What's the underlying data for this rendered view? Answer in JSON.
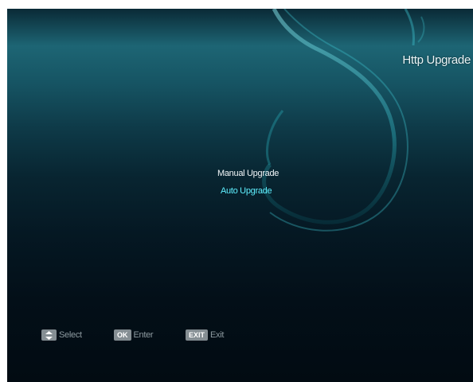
{
  "screen": {
    "title": "Http Upgrade"
  },
  "menu": {
    "items": [
      {
        "label": "Manual Upgrade",
        "selected": true
      },
      {
        "label": "Auto Upgrade",
        "selected": false
      }
    ]
  },
  "footer": {
    "hints": [
      {
        "key": "",
        "key_icon": "up-down-arrows-icon",
        "label": "Select"
      },
      {
        "key": "OK",
        "label": "Enter"
      },
      {
        "key": "EXIT",
        "label": "Exit"
      }
    ]
  },
  "colors": {
    "background_top": "#1d6574",
    "background_bottom": "#020b12",
    "accent": "#5ff0ff",
    "selected_text": "#f2f6f8",
    "key_badge": "#858e93"
  }
}
